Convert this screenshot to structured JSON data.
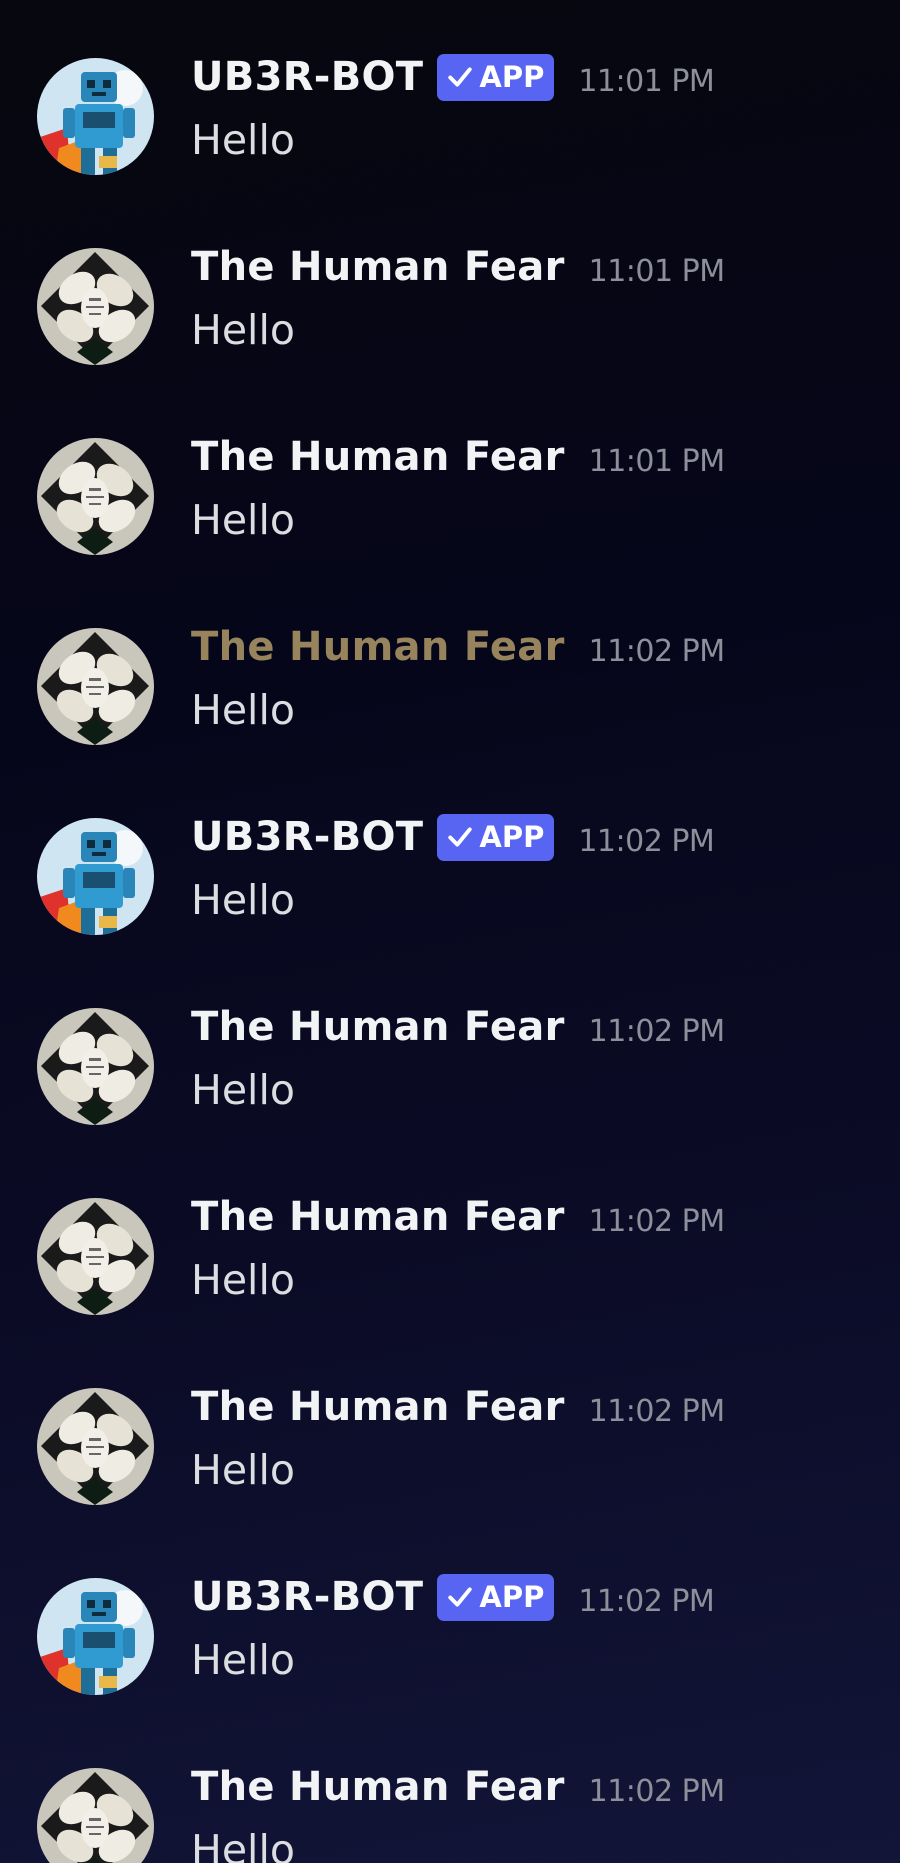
{
  "messages": [
    {
      "kind": "bot",
      "username": "UB3R-BOT",
      "badge": "APP",
      "time": "11:01 PM",
      "text": "Hello",
      "avatar": "robot-avatar"
    },
    {
      "kind": "human",
      "username": "The Human Fear",
      "time": "11:01 PM",
      "text": "Hello",
      "avatar": "hands-avatar"
    },
    {
      "kind": "human",
      "username": "The Human Fear",
      "time": "11:01 PM",
      "text": "Hello",
      "avatar": "hands-avatar"
    },
    {
      "kind": "human-gold",
      "username": "The Human Fear",
      "time": "11:02 PM",
      "text": "Hello",
      "avatar": "hands-avatar"
    },
    {
      "kind": "bot",
      "username": "UB3R-BOT",
      "badge": "APP",
      "time": "11:02 PM",
      "text": "Hello",
      "avatar": "robot-avatar"
    },
    {
      "kind": "human",
      "username": "The Human Fear",
      "time": "11:02 PM",
      "text": "Hello",
      "avatar": "hands-avatar"
    },
    {
      "kind": "human",
      "username": "The Human Fear",
      "time": "11:02 PM",
      "text": "Hello",
      "avatar": "hands-avatar"
    },
    {
      "kind": "human",
      "username": "The Human Fear",
      "time": "11:02 PM",
      "text": "Hello",
      "avatar": "hands-avatar"
    },
    {
      "kind": "bot",
      "username": "UB3R-BOT",
      "badge": "APP",
      "time": "11:02 PM",
      "text": "Hello",
      "avatar": "robot-avatar"
    },
    {
      "kind": "human",
      "username": "The Human Fear",
      "time": "11:02 PM",
      "text": "Hello",
      "avatar": "hands-avatar"
    }
  ],
  "colors": {
    "badge": "#5865f2",
    "username": "#f2f3f5",
    "username_gold": "#97845d",
    "timestamp": "#8d909a",
    "message_text": "#dcdde1"
  }
}
